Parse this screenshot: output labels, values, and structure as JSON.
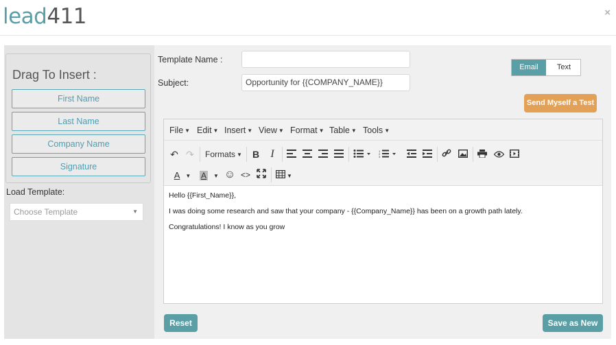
{
  "brand": {
    "logo_part1": "lead",
    "logo_part2": "411"
  },
  "close_glyph": "×",
  "sidebar": {
    "title": "Drag To Insert :",
    "fields": [
      "First Name",
      "Last Name",
      "Company Name",
      "Signature"
    ],
    "load_template_label": "Load Template:",
    "template_select": {
      "placeholder": "Choose Template"
    }
  },
  "form": {
    "template_name_label": "Template Name :",
    "template_name_value": "",
    "subject_label": "Subject:",
    "subject_value": "Opportunity for {{COMPANY_NAME}}",
    "mode_toggle": {
      "email": "Email",
      "text": "Text",
      "selected": "Email"
    },
    "send_test_label": "Send Myself a Test"
  },
  "editor": {
    "menus": [
      "File",
      "Edit",
      "Insert",
      "View",
      "Format",
      "Table",
      "Tools"
    ],
    "formats_label": "Formats",
    "toolbar_icons": [
      "undo-icon",
      "redo-icon",
      "bold-icon",
      "italic-icon",
      "align-left-icon",
      "align-center-icon",
      "align-right-icon",
      "align-justify-icon",
      "bullet-list-icon",
      "numbered-list-icon",
      "outdent-icon",
      "indent-icon",
      "link-icon",
      "image-icon",
      "print-icon",
      "preview-icon",
      "media-icon",
      "text-color-icon",
      "background-color-icon",
      "emoticon-icon",
      "code-icon",
      "fullscreen-icon",
      "table-icon"
    ],
    "content_lines": [
      "Hello {{First_Name}},",
      "I was doing some research and saw that your company - {{Company_Name}} has been on a growth path lately.",
      "Congratulations!  I know as you grow"
    ]
  },
  "actions": {
    "reset_label": "Reset",
    "save_new_label": "Save as New"
  },
  "colors": {
    "accent": "#5a9ea6",
    "orange": "#e3a057",
    "panel": "#e4e4e4",
    "main": "#f0f0f0"
  }
}
